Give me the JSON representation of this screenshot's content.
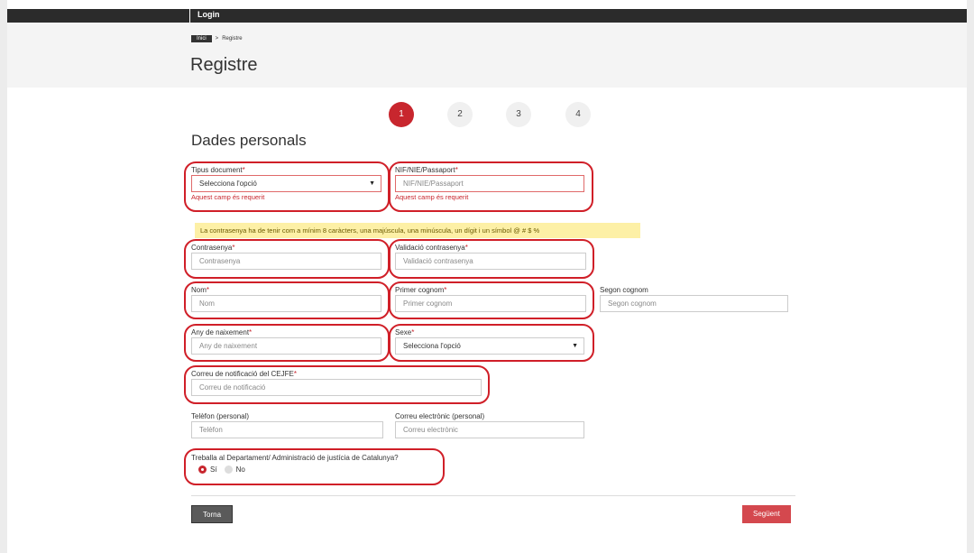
{
  "topbar": {
    "login": "Login"
  },
  "breadcrumb": {
    "home": "Inici",
    "separator": ">",
    "current": "Registre"
  },
  "page": {
    "title": "Registre",
    "section_title": "Dades personals"
  },
  "steps": [
    {
      "number": "1",
      "active": true
    },
    {
      "number": "2",
      "active": false
    },
    {
      "number": "3",
      "active": false
    },
    {
      "number": "4",
      "active": false
    }
  ],
  "fields": {
    "doc_type": {
      "label": "Tipus document",
      "required": "*",
      "value": "Selecciona l'opció",
      "error": "Aquest camp és requerit"
    },
    "nif": {
      "label": "NIF/NIE/Passaport",
      "required": "*",
      "placeholder": "NIF/NIE/Passaport",
      "error": "Aquest camp és requerit"
    },
    "password_note": "La contrasenya ha de tenir com a mínim 8 caràcters, una majúscula, una minúscula, un dígit i un símbol @ # $ %",
    "password": {
      "label": "Contrasenya",
      "required": "*",
      "placeholder": "Contrasenya"
    },
    "password_confirm": {
      "label": "Validació contrasenya",
      "required": "*",
      "placeholder": "Validació contrasenya"
    },
    "name": {
      "label": "Nom",
      "required": "*",
      "placeholder": "Nom"
    },
    "surname1": {
      "label": "Primer cognom",
      "required": "*",
      "placeholder": "Primer cognom"
    },
    "surname2": {
      "label": "Segon cognom",
      "placeholder": "Segon cognom"
    },
    "birth_year": {
      "label": "Any de naixement",
      "required": "*",
      "placeholder": "Any de naixement"
    },
    "sex": {
      "label": "Sexe",
      "required": "*",
      "value": "Selecciona l'opció"
    },
    "notif_email": {
      "label": "Correu de notificació del CEJFE",
      "required": "*",
      "placeholder": "Correu de notificació"
    },
    "phone": {
      "label": "Telèfon (personal)",
      "placeholder": "Telèfon"
    },
    "email": {
      "label": "Correu electrònic (personal)",
      "placeholder": "Correu electrònic"
    },
    "works_question": {
      "label": "Treballa al Departament/ Administració de justícia de Catalunya?",
      "options": [
        "Sí",
        "No"
      ],
      "selected": "Sí"
    }
  },
  "buttons": {
    "back": "Torna",
    "next": "Següent"
  },
  "colors": {
    "accent": "#c8262e",
    "highlight_ring": "#d01f28",
    "note_bg": "#fdf0a6"
  }
}
